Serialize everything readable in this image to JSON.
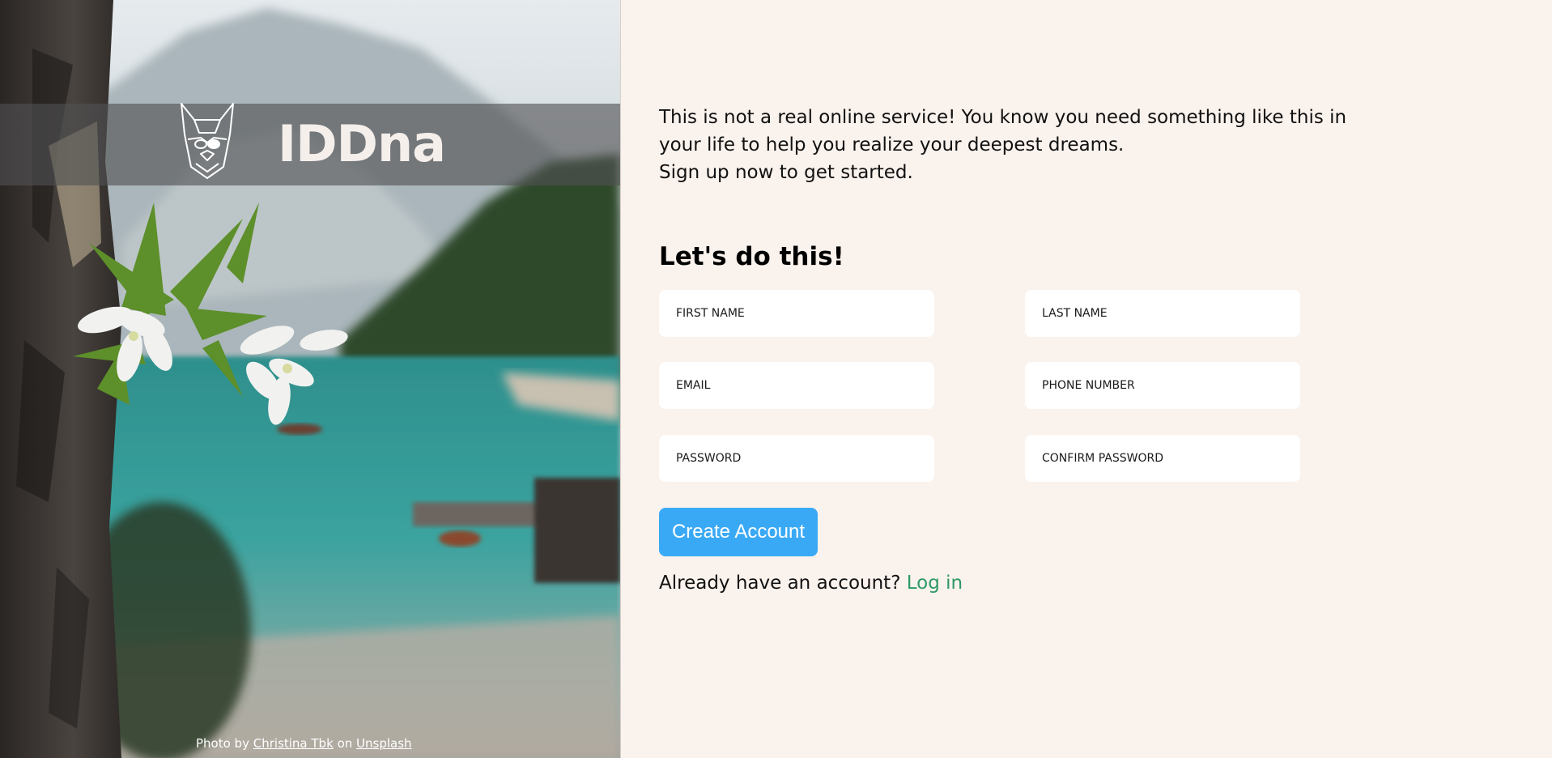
{
  "brand": {
    "name": "IDDna",
    "logo_icon": "dog-head-icon"
  },
  "photo_credit": {
    "prefix": "Photo by",
    "author": "Christina Tbk",
    "middle": "on",
    "site": "Unsplash"
  },
  "intro": {
    "line1": "This is not a real online service! You know you need something like this in",
    "line2": "your life to help you realize your deepest dreams.",
    "line3": "Sign up now to get started."
  },
  "form": {
    "heading": "Let's do this!",
    "fields": {
      "first_name": {
        "placeholder": "FIRST NAME",
        "value": ""
      },
      "last_name": {
        "placeholder": "LAST NAME",
        "value": ""
      },
      "email": {
        "placeholder": "EMAIL",
        "value": ""
      },
      "phone": {
        "placeholder": "PHONE NUMBER",
        "value": ""
      },
      "password": {
        "placeholder": "PASSWORD",
        "value": ""
      },
      "confirm_password": {
        "placeholder": "CONFIRM PASSWORD",
        "value": ""
      }
    },
    "submit_label": "Create Account",
    "login_prompt": "Already have an account?",
    "login_link": "Log in"
  },
  "colors": {
    "page_background": "#faf2ed",
    "button": "#3aa9f5",
    "link": "#2e9a66",
    "band": "#505052"
  }
}
